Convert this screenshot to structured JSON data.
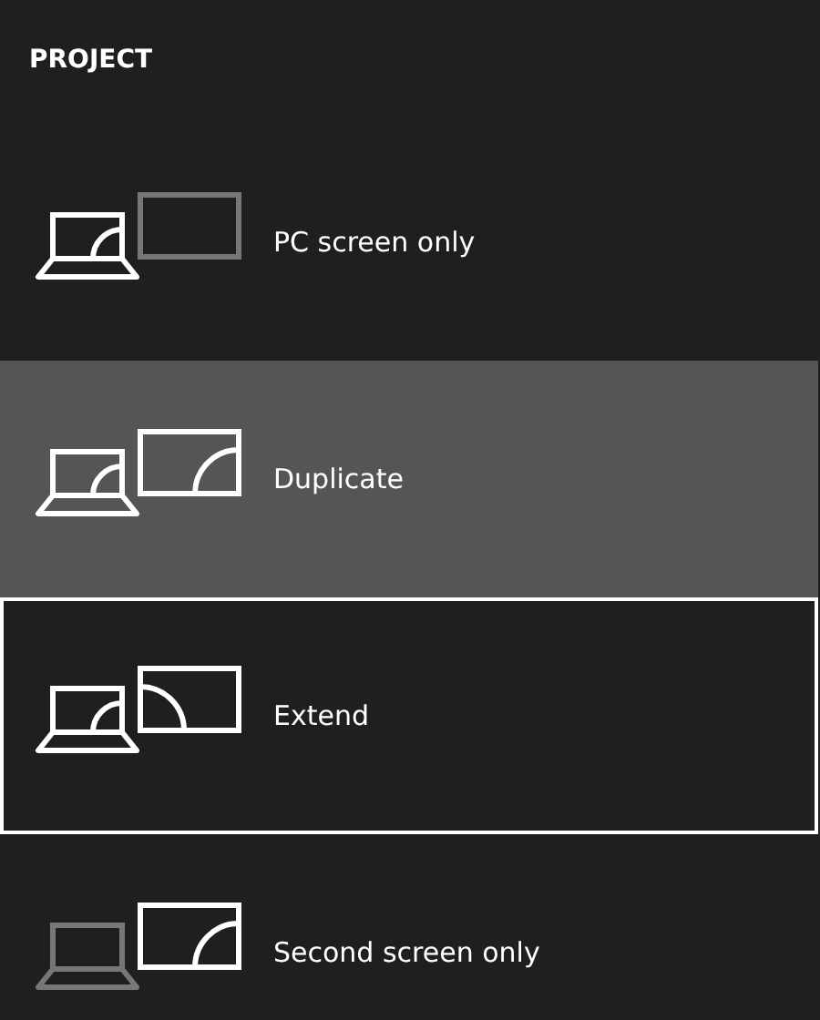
{
  "header": "PROJECT",
  "options": [
    {
      "kind": "pc_only",
      "label": "PC screen only",
      "selected": false,
      "focused": false
    },
    {
      "kind": "duplicate",
      "label": "Duplicate",
      "selected": true,
      "focused": false
    },
    {
      "kind": "extend",
      "label": "Extend",
      "selected": false,
      "focused": true
    },
    {
      "kind": "second_only",
      "label": "Second screen only",
      "selected": false,
      "focused": false
    }
  ]
}
